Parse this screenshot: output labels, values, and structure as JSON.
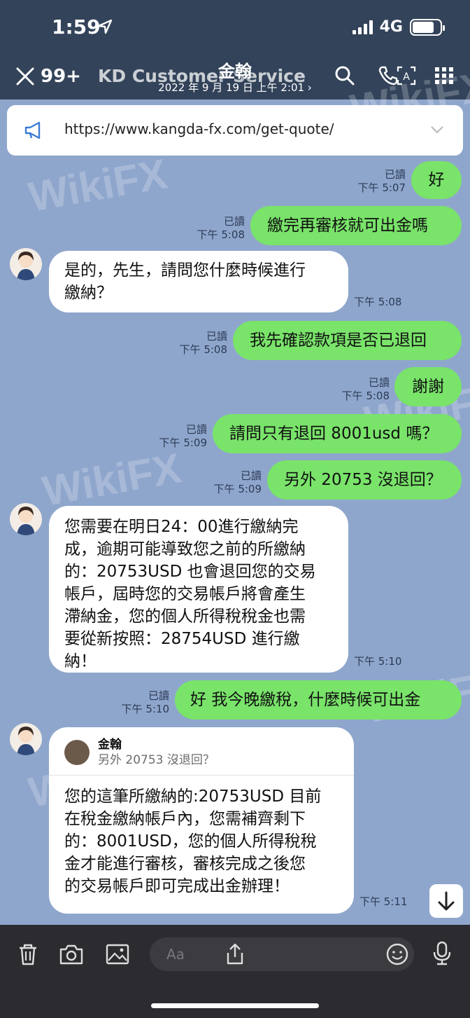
{
  "status": {
    "time": "1:59",
    "network": "4G"
  },
  "header": {
    "unread_count": "99+",
    "background_title": "KD Customer Service",
    "chat_name": "金翰",
    "chat_subtitle": "2022 年 9 月 19 日 上午 2:01 ›"
  },
  "announcement": {
    "url": "https://www.kangda-fx.com/get-quote/"
  },
  "watermark": "WikiFX",
  "messages": [
    {
      "side": "me",
      "text": "好",
      "read": "已讀",
      "time": "下午 5:07"
    },
    {
      "side": "me",
      "text": "繳完再審核就可出金嗎",
      "read": "已讀",
      "time": "下午 5:08"
    },
    {
      "side": "them",
      "text": "是的，先生，請問您什麼時候進行\n繳納？",
      "time": "下午 5:08"
    },
    {
      "side": "me",
      "text": "我先確認款項是否已退回",
      "read": "已讀",
      "time": "下午 5:08"
    },
    {
      "side": "me",
      "text": "謝謝",
      "read": "已讀",
      "time": "下午 5:08"
    },
    {
      "side": "me",
      "text": "請問只有退回 8001usd 嗎？",
      "read": "已讀",
      "time": "下午 5:09"
    },
    {
      "side": "me",
      "text": "另外 20753 沒退回？",
      "read": "已讀",
      "time": "下午 5:09"
    },
    {
      "side": "them",
      "text": "您需要在明日24：00進行繳納完\n成，逾期可能導致您之前的所繳納\n的：20753USD 也會退回您的交易\n帳戶，屆時您的交易帳戶將會產生\n滯納金，您的個人所得稅稅金也需\n要從新按照：28754USD 進行繳\n納！",
      "time": "下午 5:10"
    },
    {
      "side": "me",
      "text": "好 我今晚繳稅，什麼時候可出金",
      "read": "已讀",
      "time": "下午 5:10"
    },
    {
      "side": "them",
      "reply_name": "金翰",
      "reply_quote": "另外 20753 沒退回？",
      "text": "您的這筆所繳納的:20753USD 目前\n在稅金繳納帳戶內，您需補齊剩下\n的：8001USD，您的個人所得稅稅\n金才能進行審核，審核完成之後您\n的交易帳戶即可完成出金辦理！",
      "time": "下午 5:11"
    }
  ],
  "input": {
    "placeholder": "Aa"
  }
}
